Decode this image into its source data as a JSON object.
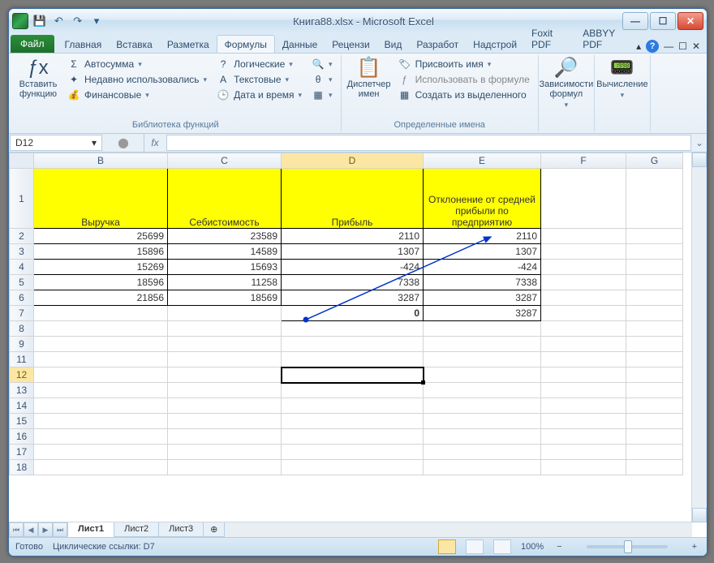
{
  "window": {
    "title": "Книга88.xlsx - Microsoft Excel"
  },
  "qat": {
    "save": "💾",
    "undo": "↶",
    "redo": "↷",
    "more": "▾"
  },
  "winbuttons": {
    "min": "—",
    "max": "☐",
    "close": "✕"
  },
  "tabs": {
    "file": "Файл",
    "home": "Главная",
    "insert": "Вставка",
    "layout": "Разметка",
    "formulas": "Формулы",
    "data": "Данные",
    "review": "Рецензи",
    "view": "Вид",
    "developer": "Разработ",
    "addins": "Надстрой",
    "foxit": "Foxit PDF",
    "abbyy": "ABBYY PDF"
  },
  "ribbon": {
    "insert_fn": {
      "label": "Вставить функцию",
      "icon": "ƒx"
    },
    "autosum": "Автосумма",
    "recent": "Недавно использовались",
    "financial": "Финансовые",
    "logical": "Логические",
    "text": "Текстовые",
    "datetime": "Дата и время",
    "name_mgr": {
      "label": "Диспетчер имен",
      "icon": "📋"
    },
    "define_name": "Присвоить имя",
    "use_in_formula": "Использовать в формуле",
    "create_from_sel": "Создать из выделенного",
    "trace": {
      "label": "Зависимости формул",
      "icon": "🔎"
    },
    "calc": {
      "label": "Вычисление",
      "icon": "📟"
    },
    "group_lib": "Библиотека функций",
    "group_names": "Определенные имена"
  },
  "namebox": "D12",
  "fx_label": "fx",
  "columns": [
    "B",
    "C",
    "D",
    "E",
    "F",
    "G"
  ],
  "selected_col": "D",
  "selected_row": 12,
  "row_numbers": [
    1,
    2,
    3,
    4,
    5,
    6,
    7,
    8,
    9,
    11,
    12,
    13,
    14,
    15,
    16,
    17,
    18
  ],
  "headers": {
    "B": "Выручка",
    "C": "Себистоимость",
    "D": "Прибыль",
    "E": "Отклонение от средней прибыли по предприятию"
  },
  "rows": [
    {
      "B": "25699",
      "C": "23589",
      "D": "2110",
      "E": "2110"
    },
    {
      "B": "15896",
      "C": "14589",
      "D": "1307",
      "E": "1307"
    },
    {
      "B": "15269",
      "C": "15693",
      "D": "-424",
      "E": "-424"
    },
    {
      "B": "18596",
      "C": "11258",
      "D": "7338",
      "E": "7338"
    },
    {
      "B": "21856",
      "C": "18569",
      "D": "3287",
      "E": "3287"
    }
  ],
  "row7": {
    "D": "0",
    "E": "3287"
  },
  "sheets": {
    "s1": "Лист1",
    "s2": "Лист2",
    "s3": "Лист3",
    "add": "⊕"
  },
  "status": {
    "ready": "Готово",
    "circular": "Циклические ссылки: D7",
    "zoom": "100%",
    "minus": "−",
    "plus": "+"
  },
  "collapse": "▴",
  "innerwin": {
    "min": "—",
    "max": "☐",
    "close": "✕"
  },
  "chart_data": null
}
